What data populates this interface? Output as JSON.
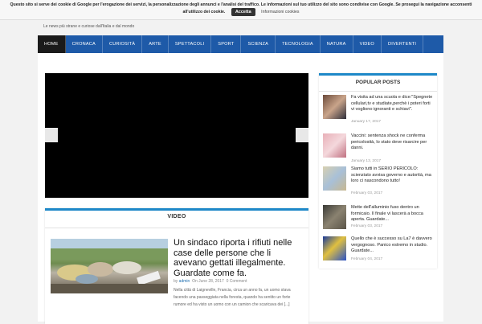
{
  "cookie_bar": {
    "text": "Questo sito si serve dei cookie di Google per l'erogazione dei servizi, la personalizzazione degli annunci e l'analisi del traffico. Le informazioni sul tuo utilizzo del sito sono condivise con Google. Se prosegui la navigazione acconsenti",
    "text_line2": "all'utilizzo dei cookie.",
    "accept_label": "Accetta",
    "info_label": "Informazioni cookies"
  },
  "header": {
    "tagline": "Le news più strane e curiose dall'Italia e dal mondo"
  },
  "nav": {
    "items": [
      "HOME",
      "CRONACA",
      "CURIOSITÀ",
      "ARTE",
      "SPETTACOLI",
      "SPORT",
      "SCIENZA",
      "TECNOLOGIA",
      "NATURA",
      "VIDEO",
      "DIVERTENTI"
    ]
  },
  "video_section": {
    "heading": "VIDEO",
    "post": {
      "title": "Un sindaco riporta i rifiuti nelle case delle persone che li avevano gettati illegalmente. Guardate come fa.",
      "author": "admin",
      "date": "On June 28, 2017",
      "comments": "0 Comment",
      "excerpt": "Nella città di Laigneville, Francia, circa un anno fa, un uomo stava facendo una passeggiata nella foresta, quando ha sentito un forte rumore ed ha visto un uomo con un camion che scaricava dei [...]"
    }
  },
  "popular": {
    "heading": "POPULAR POSTS",
    "items": [
      {
        "title": "Fa visita ad una scuola e dice:\"Spegnete cellulari,tv e studiate,perchè i poteri forti vi vogliono ignoranti e schiavi\".",
        "date": "January 17, 2017"
      },
      {
        "title": "Vaccini: sentenza shock ne conferma pericolosità, lo stato deve risarcire per danni.",
        "date": "January 13, 2017"
      },
      {
        "title": "Siamo tutti in SERIO PERICOLO: scienziato avvisa governo e autorità, ma loro ci nascondono tutto!",
        "date": "February 03, 2017"
      },
      {
        "title": "Mette dell'alluminio fuso dentro un formicaio. Il finale vi lascerà a bocca aperta. Guardate...",
        "date": "February 03, 2017"
      },
      {
        "title": "Quello che è successo su La7 è davvero vergognoso. Panico estremo in studio. Guardate...",
        "date": "February 04, 2017"
      }
    ]
  },
  "colors": {
    "nav_blue": "#1e5aa8",
    "accent_blue": "#1e88c8",
    "nav_active": "#1a1a1a"
  }
}
